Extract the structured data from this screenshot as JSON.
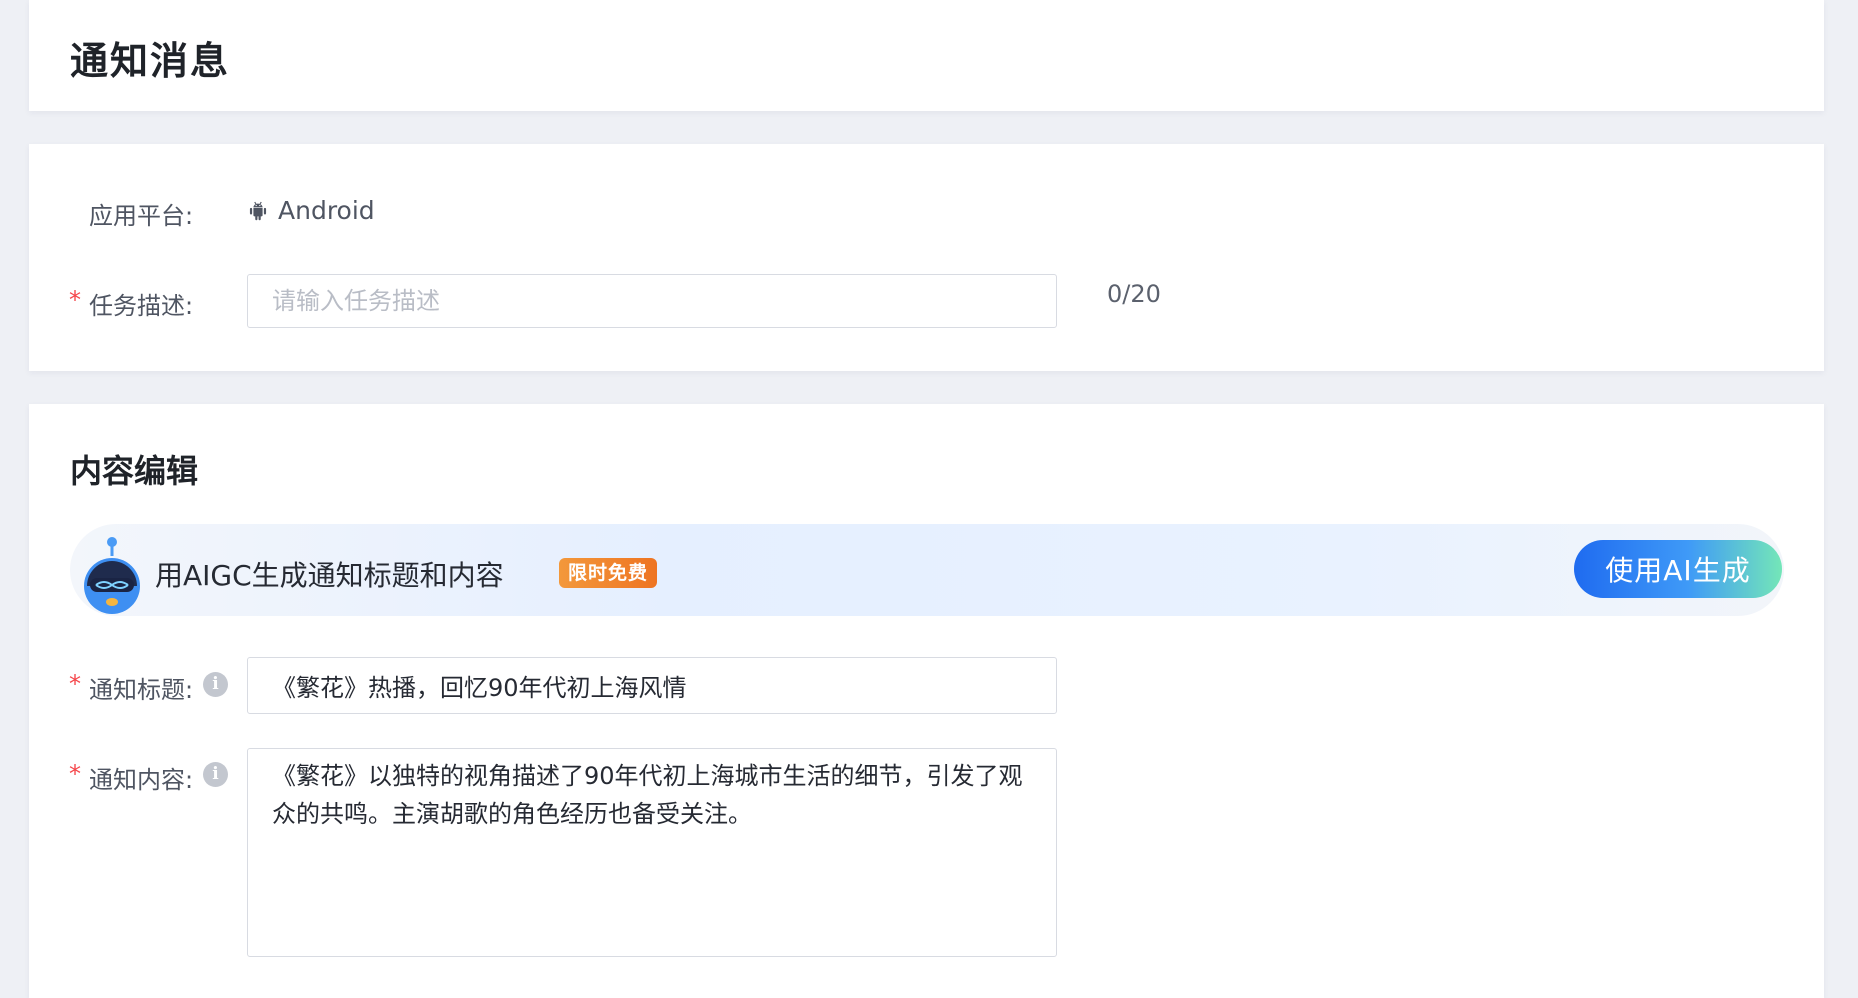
{
  "header": {
    "title": "通知消息"
  },
  "basic": {
    "platform_label": "应用平台:",
    "platform_value": "Android",
    "task_label": "任务描述:",
    "task_placeholder": "请输入任务描述",
    "task_value": "",
    "task_counter": "0/20",
    "required_mark": "*",
    "platform_icon": "android-icon"
  },
  "content": {
    "section_title": "内容编辑",
    "aigc_text": "用AIGC生成通知标题和内容",
    "free_badge": "限时免费",
    "ai_button": "使用AI生成",
    "title_label": "通知标题:",
    "title_value": "《繁花》热播，回忆90年代初上海风情",
    "body_label": "通知内容:",
    "body_value": "《繁花》以独特的视角描述了90年代初上海城市生活的细节，引发了观众的共鸣。主演胡歌的角色经历也备受关注。",
    "info_icon": "info-icon",
    "info_glyph": "i",
    "required_mark": "*"
  },
  "colors": {
    "accent": "#1f6bf0",
    "required": "#f5464b",
    "badge": "#ee7422"
  }
}
